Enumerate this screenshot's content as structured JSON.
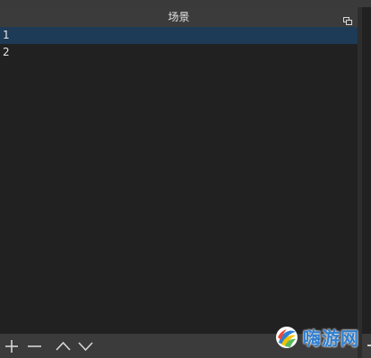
{
  "dock": {
    "title": "场景"
  },
  "scenes": [
    {
      "label": "1",
      "selected": true
    },
    {
      "label": "2",
      "selected": false
    }
  ],
  "toolbar": {
    "buttons": [
      {
        "name": "add-scene-button",
        "icon": "plus-icon"
      },
      {
        "name": "remove-scene-button",
        "icon": "minus-icon"
      },
      {
        "name": "move-scene-up-button",
        "icon": "chevron-up-icon"
      },
      {
        "name": "move-scene-down-button",
        "icon": "chevron-down-icon"
      }
    ]
  },
  "watermark": {
    "text": "嗨游网"
  },
  "colors": {
    "selection": "#1d3a56",
    "panel_bg": "#212121",
    "header_bg": "#3b3b3b",
    "watermark_text": "#2f7fd0"
  }
}
